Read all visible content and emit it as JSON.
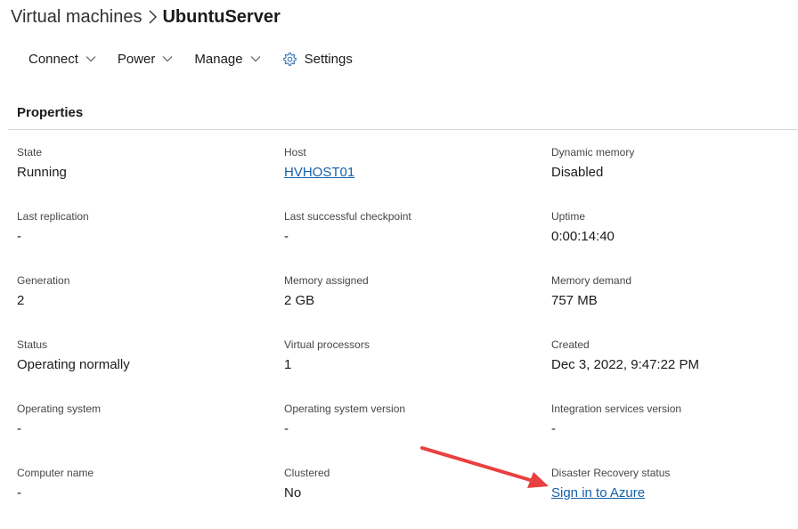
{
  "breadcrumb": {
    "parent": "Virtual machines",
    "current": "UbuntuServer"
  },
  "toolbar": {
    "connect_label": "Connect",
    "power_label": "Power",
    "manage_label": "Manage",
    "settings_label": "Settings"
  },
  "properties": {
    "title": "Properties",
    "state": {
      "label": "State",
      "value": "Running"
    },
    "host": {
      "label": "Host",
      "value": "HVHOST01"
    },
    "dynamic_memory": {
      "label": "Dynamic memory",
      "value": "Disabled"
    },
    "last_replication": {
      "label": "Last replication",
      "value": "-"
    },
    "last_checkpoint": {
      "label": "Last successful checkpoint",
      "value": "-"
    },
    "uptime": {
      "label": "Uptime",
      "value": "0:00:14:40"
    },
    "generation": {
      "label": "Generation",
      "value": "2"
    },
    "memory_assigned": {
      "label": "Memory assigned",
      "value": "2 GB"
    },
    "memory_demand": {
      "label": "Memory demand",
      "value": "757 MB"
    },
    "status": {
      "label": "Status",
      "value": "Operating normally"
    },
    "virtual_processors": {
      "label": "Virtual processors",
      "value": "1"
    },
    "created": {
      "label": "Created",
      "value": "Dec 3, 2022, 9:47:22 PM"
    },
    "operating_system": {
      "label": "Operating system",
      "value": "-"
    },
    "os_version": {
      "label": "Operating system version",
      "value": "-"
    },
    "integration_services": {
      "label": "Integration services version",
      "value": "-"
    },
    "computer_name": {
      "label": "Computer name",
      "value": "-"
    },
    "clustered": {
      "label": "Clustered",
      "value": "No"
    },
    "disaster_recovery": {
      "label": "Disaster Recovery status",
      "value": "Sign in to Azure"
    }
  },
  "colors": {
    "link": "#1460aa",
    "annotation_arrow": "#e8403f"
  },
  "icons": {
    "breadcrumb_separator": "chevron-right-icon",
    "dropdown": "chevron-down-icon",
    "settings": "gear-icon"
  }
}
